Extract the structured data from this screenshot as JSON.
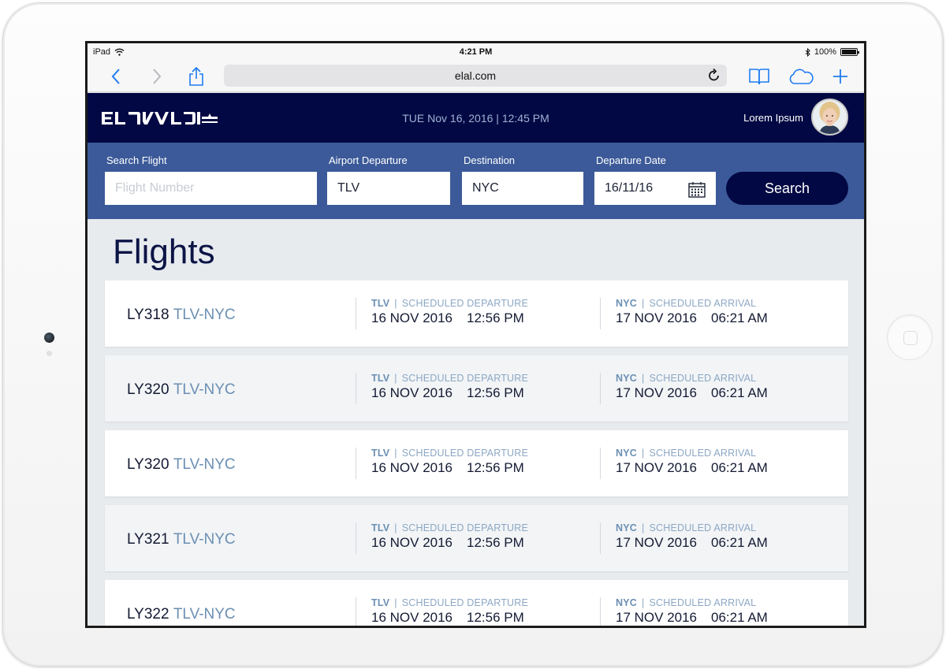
{
  "statusbar": {
    "device": "iPad",
    "time": "4:21 PM",
    "battery": "100%"
  },
  "browser": {
    "url": "elal.com"
  },
  "header": {
    "logo_text": "EL AL",
    "datetime": "TUE Nov 16, 2016  |  12:45 PM",
    "user_name": "Lorem Ipsum"
  },
  "search": {
    "flight_label": "Search Flight",
    "flight_placeholder": "Flight Number",
    "flight_value": "",
    "departure_label": "Airport Departure",
    "departure_value": "TLV",
    "destination_label": "Destination",
    "destination_value": "NYC",
    "date_label": "Departure Date",
    "date_value": "16/11/16",
    "button_label": "Search"
  },
  "page": {
    "title": "Flights"
  },
  "flights": [
    {
      "prefix": "LY318",
      "route": "TLV-NYC",
      "dep_code": "TLV",
      "dep_label": "SCHEDULED DEPARTURE",
      "dep_date": "16 NOV 2016",
      "dep_time": "12:56 PM",
      "arr_code": "NYC",
      "arr_label": "SCHEDULED ARRIVAL",
      "arr_date": "17 NOV 2016",
      "arr_time": "06:21 AM"
    },
    {
      "prefix": "LY320",
      "route": "TLV-NYC",
      "dep_code": "TLV",
      "dep_label": "SCHEDULED DEPARTURE",
      "dep_date": "16 NOV 2016",
      "dep_time": "12:56 PM",
      "arr_code": "NYC",
      "arr_label": "SCHEDULED ARRIVAL",
      "arr_date": "17 NOV 2016",
      "arr_time": "06:21 AM"
    },
    {
      "prefix": "LY320",
      "route": "TLV-NYC",
      "dep_code": "TLV",
      "dep_label": "SCHEDULED DEPARTURE",
      "dep_date": "16 NOV 2016",
      "dep_time": "12:56 PM",
      "arr_code": "NYC",
      "arr_label": "SCHEDULED ARRIVAL",
      "arr_date": "17 NOV 2016",
      "arr_time": "06:21 AM"
    },
    {
      "prefix": "LY321",
      "route": "TLV-NYC",
      "dep_code": "TLV",
      "dep_label": "SCHEDULED DEPARTURE",
      "dep_date": "16 NOV 2016",
      "dep_time": "12:56 PM",
      "arr_code": "NYC",
      "arr_label": "SCHEDULED ARRIVAL",
      "arr_date": "17 NOV 2016",
      "arr_time": "06:21 AM"
    },
    {
      "prefix": "LY322",
      "route": "TLV-NYC",
      "dep_code": "TLV",
      "dep_label": "SCHEDULED DEPARTURE",
      "dep_date": "16 NOV 2016",
      "dep_time": "12:56 PM",
      "arr_code": "NYC",
      "arr_label": "SCHEDULED ARRIVAL",
      "arr_date": "17 NOV 2016",
      "arr_time": "06:21 AM"
    }
  ],
  "colors": {
    "header_bg": "#020843",
    "search_panel_bg": "#3c5a99",
    "route_accent": "#6b8fb3",
    "page_bg": "#e8ebee"
  },
  "icons": [
    "wifi-icon",
    "bluetooth-icon",
    "back-icon",
    "forward-icon",
    "share-icon",
    "reload-icon",
    "bookmarks-icon",
    "cloud-icon",
    "new-tab-icon",
    "calendar-icon"
  ]
}
